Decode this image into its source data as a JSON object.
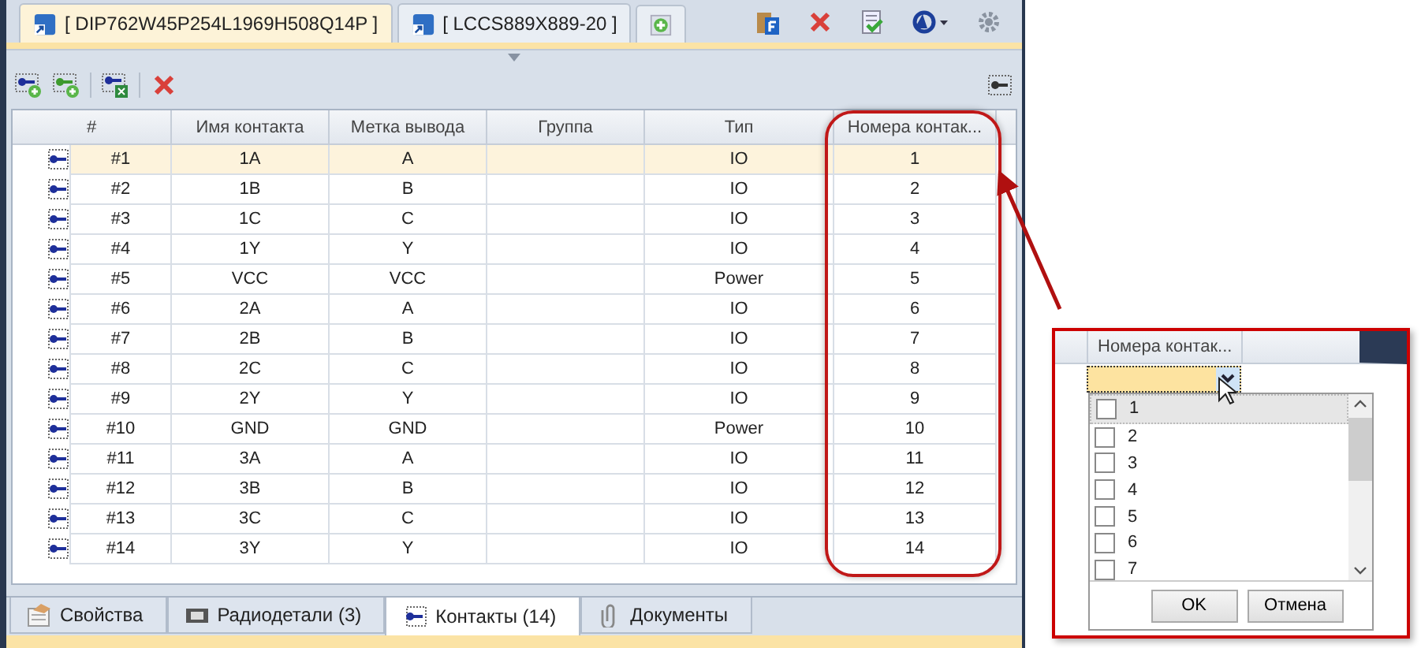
{
  "document_tabs": [
    {
      "label": "[ DIP762W45P254L1969H508Q14P ]",
      "selected": true
    },
    {
      "label": "[ LCCS889X889-20 ]",
      "selected": false
    }
  ],
  "table": {
    "columns": [
      "#",
      "Имя контакта",
      "Метка вывода",
      "Группа",
      "Тип",
      "Номера контак..."
    ],
    "rows": [
      {
        "number": "#1",
        "name": "1A",
        "label": "A",
        "type": "IO",
        "pins": "1",
        "selected": true
      },
      {
        "number": "#2",
        "name": "1B",
        "label": "B",
        "type": "IO",
        "pins": "2",
        "selected": false
      },
      {
        "number": "#3",
        "name": "1C",
        "label": "C",
        "type": "IO",
        "pins": "3",
        "selected": false
      },
      {
        "number": "#4",
        "name": "1Y",
        "label": "Y",
        "type": "IO",
        "pins": "4",
        "selected": false
      },
      {
        "number": "#5",
        "name": "VCC",
        "label": "VCC",
        "type": "Power",
        "pins": "5",
        "selected": false
      },
      {
        "number": "#6",
        "name": "2A",
        "label": "A",
        "type": "IO",
        "pins": "6",
        "selected": false
      },
      {
        "number": "#7",
        "name": "2B",
        "label": "B",
        "type": "IO",
        "pins": "7",
        "selected": false
      },
      {
        "number": "#8",
        "name": "2C",
        "label": "C",
        "type": "IO",
        "pins": "8",
        "selected": false
      },
      {
        "number": "#9",
        "name": "2Y",
        "label": "Y",
        "type": "IO",
        "pins": "9",
        "selected": false
      },
      {
        "number": "#10",
        "name": "GND",
        "label": "GND",
        "type": "Power",
        "pins": "10",
        "selected": false
      },
      {
        "number": "#11",
        "name": "3A",
        "label": "A",
        "type": "IO",
        "pins": "11",
        "selected": false
      },
      {
        "number": "#12",
        "name": "3B",
        "label": "B",
        "type": "IO",
        "pins": "12",
        "selected": false
      },
      {
        "number": "#13",
        "name": "3C",
        "label": "C",
        "type": "IO",
        "pins": "13",
        "selected": false
      },
      {
        "number": "#14",
        "name": "3Y",
        "label": "Y",
        "type": "IO",
        "pins": "14",
        "selected": false
      }
    ]
  },
  "bottom_tabs": [
    {
      "label": "Свойства",
      "selected": false
    },
    {
      "label": "Радиодетали (3)",
      "selected": false
    },
    {
      "label": "Контакты (14)",
      "selected": true
    },
    {
      "label": "Документы",
      "selected": false
    }
  ],
  "inset": {
    "column": "Номера контак...",
    "options": [
      {
        "label": "1",
        "checked": false,
        "selected": true
      },
      {
        "label": "2",
        "checked": false,
        "selected": false
      },
      {
        "label": "3",
        "checked": false,
        "selected": false
      },
      {
        "label": "4",
        "checked": false,
        "selected": false
      },
      {
        "label": "5",
        "checked": false,
        "selected": false
      },
      {
        "label": "6",
        "checked": false,
        "selected": false
      },
      {
        "label": "7",
        "checked": false,
        "selected": false
      }
    ],
    "buttons": [
      "OK",
      "Отмена"
    ]
  }
}
